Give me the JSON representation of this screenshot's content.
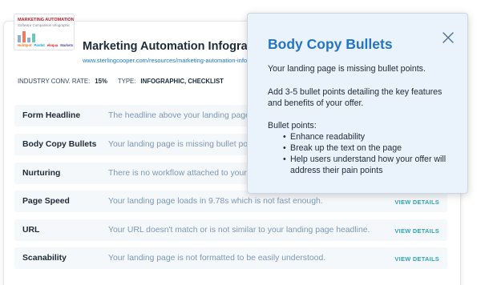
{
  "asset": {
    "thumbnail": {
      "title": "MARKETING AUTOMATION",
      "subtitle": "Software Comparison Infographic",
      "logos": [
        "HubSpot",
        "Pardot",
        "eloqua",
        "Marketo"
      ],
      "logo_colors": [
        "#f57722",
        "#00a1e0",
        "#d8232a",
        "#5c4c9f"
      ]
    },
    "title": "Marketing Automation Infographic",
    "url": "www.sterlingcooper.com/resources/marketing-automation-infographic"
  },
  "meta": {
    "conv_rate_label": "INDUSTRY CONV. RATE:",
    "conv_rate_value": "15%",
    "type_label": "TYPE:",
    "type_value": "INFOGRAPHIC, CHECKLIST"
  },
  "rows": [
    {
      "name": "Form Headline",
      "message": "The headline above your landing page",
      "link": ""
    },
    {
      "name": "Body Copy Bullets",
      "message": "Your landing page is missing bullet points.",
      "link": ""
    },
    {
      "name": "Nurturing",
      "message": "There is no workflow attached to your",
      "link": ""
    },
    {
      "name": "Page Speed",
      "message": "Your landing page loads in 9.78s which is not fast enough.",
      "link": "VIEW DETAILS"
    },
    {
      "name": "URL",
      "message": "Your URL doesn't match or is not similar to your landing page headline.",
      "link": "VIEW DETAILS"
    },
    {
      "name": "Scanability",
      "message": "Your landing page is not formatted to be easily understood.",
      "link": "VIEW DETAILS"
    }
  ],
  "popover": {
    "title": "Body Copy Bullets",
    "intro": "Your landing page is missing bullet points.",
    "instruction": "Add 3-5 bullet points detailing the key features and benefits of your offer.",
    "list_label": "Bullet points:",
    "bullets": [
      "Enhance readability",
      "Break up the text on the page",
      "Help users understand how your offer will address their pain points"
    ]
  },
  "colors": {
    "accent": "#2575c7",
    "link_teal": "#2fa4b7",
    "popover_bg": "#eaf2fb",
    "row_bg": "#f5f8fa"
  },
  "icons": {
    "close": "close-icon"
  }
}
